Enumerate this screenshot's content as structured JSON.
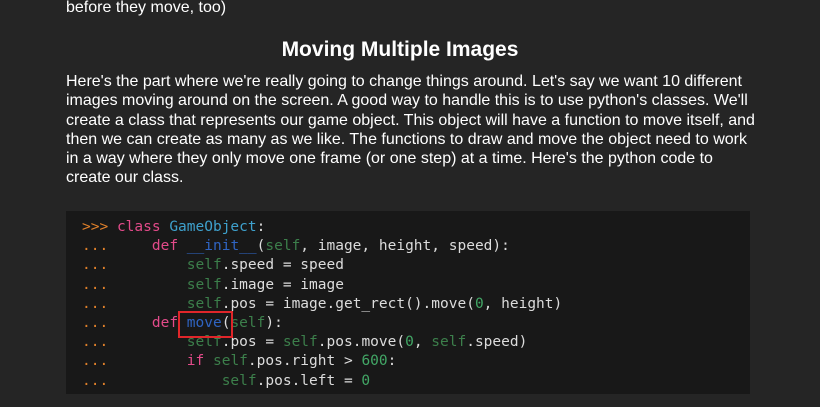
{
  "top_fragment": "before they move, too)",
  "heading": "Moving Multiple Images",
  "paragraph": "Here's the part where we're really going to change things around. Let's say we want 10 different images moving around on the screen. A good way to handle this is to use python's classes. We'll create a class that represents our game object. This object will have a function to move itself, and then we can create as many as we like. The functions to draw and move the object need to work in a way where they only move one frame (or one step) at a time. Here's the python code to create our class.",
  "code": {
    "lines": [
      {
        "prompt": ">>>",
        "text": "class GameObject:"
      },
      {
        "prompt": "...",
        "text": "def __init__(self, image, height, speed):"
      },
      {
        "prompt": "...",
        "text": "self.speed = speed"
      },
      {
        "prompt": "...",
        "text": "self.image = image"
      },
      {
        "prompt": "...",
        "text": "self.pos = image.get_rect().move(0, height)"
      },
      {
        "prompt": "...",
        "text": "def move(self):"
      },
      {
        "prompt": "...",
        "text": "self.pos = self.pos.move(0, self.speed)"
      },
      {
        "prompt": "...",
        "text": "if self.pos.right > 600:"
      },
      {
        "prompt": "...",
        "text": "self.pos.left = 0"
      }
    ],
    "highlighted_token": "move"
  },
  "colors": {
    "background": "#252525",
    "code_background": "#181818",
    "prompt": "#e0802a",
    "keyword": "#e34b8a",
    "function_name": "#3ea0cc",
    "dunder": "#2f64c2",
    "self": "#3c7f4b",
    "number": "#42a766",
    "highlight_box": "#e0262a"
  }
}
